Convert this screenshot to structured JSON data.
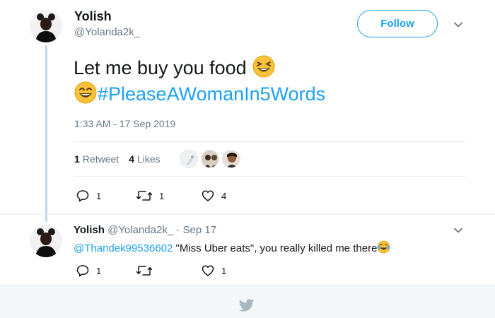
{
  "main_tweet": {
    "author_name": "Yolish",
    "author_handle": "@Yolanda2k_",
    "follow_label": "Follow",
    "text_line1": "Let me buy you food",
    "hashtag": "#PleaseAWomanIn5Words",
    "timestamp": "1:33 AM - 17 Sep 2019",
    "retweet_count": "1",
    "retweet_label": "Retweet",
    "like_count": "4",
    "like_label": "Likes",
    "actions": {
      "reply_count": "1",
      "retweet_count": "1",
      "like_count": "4"
    }
  },
  "reply_tweet": {
    "author_name": "Yolish",
    "author_handle": "@Yolanda2k_",
    "date": "· Sep 17",
    "mention": "@Thandek99536602",
    "text": " \"Miss Uber eats\", you really killed me there",
    "actions": {
      "reply_count": "1",
      "like_count": "1"
    }
  },
  "icons": [
    "avatar",
    "chevron-down-icon",
    "grinning-squinting-emoji",
    "grinning-smile-emoji",
    "reply-icon",
    "retweet-icon",
    "heart-icon",
    "tears-of-joy-emoji",
    "twitter-bird-icon"
  ],
  "colors": {
    "accent": "#1da1f2",
    "text": "#14171a",
    "muted": "#657786",
    "thread_line": "#c3d4e6",
    "footer_bg": "#f5f8fa"
  }
}
